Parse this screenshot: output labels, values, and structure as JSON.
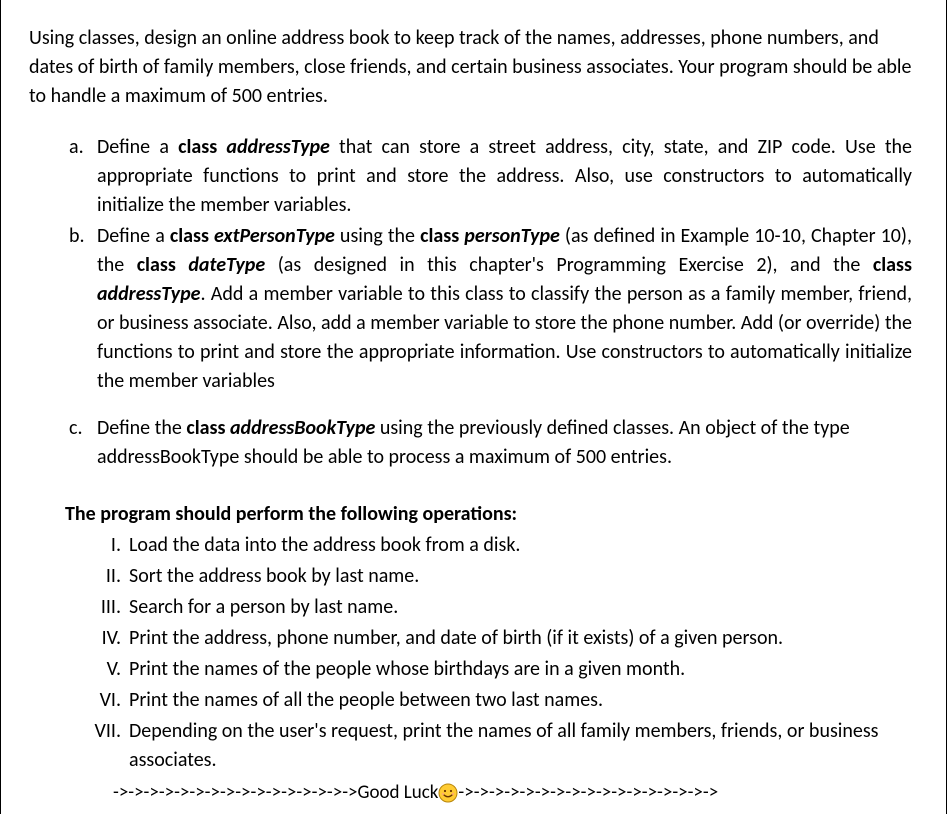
{
  "intro": "Using classes, design an online address book to keep track of the names, addresses, phone numbers, and dates of birth of family members, close friends, and certain business associates. Your program should be able to handle a maximum of 500 entries.",
  "letters": {
    "a": {
      "marker": "a.",
      "pre1": "Define a ",
      "class_word": "class ",
      "class_name": "addressType",
      "post1": " that can store a street address, city, state,  and ZIP code. Use the appropriate functions to print and store the address. Also, use constructors to automatically initialize the member variables."
    },
    "b": {
      "marker": "b.",
      "pre1": "Define a ",
      "class_word1": "class ",
      "class_name1": "extPersonType",
      "mid1": " using the ",
      "class_word2": "class ",
      "class_name2": "personType",
      "mid2": " (as defined in Example 10-10, Chapter 10), the ",
      "class_word3": "class ",
      "class_name3": "dateType",
      "mid3": " (as designed in this chapter's Programming Exercise 2), and the ",
      "class_word4": "class ",
      "class_name4": "addressType",
      "post1": ". Add a member variable to this class to classify the person as a family member, friend, or business associate. Also, add a member variable to store the phone number. Add (or override) the functions to print and store the appropriate information. Use constructors to automatically initialize the member variables"
    },
    "c": {
      "marker": "c.",
      "pre1": "Define the ",
      "class_word": "class ",
      "class_name": "addressBookType",
      "post1": " using the previously defined classes. An object of the type addressBookType should be able to process a maximum of 500 entries."
    }
  },
  "ops_header": "The program should perform the following operations:",
  "roman": {
    "i1": {
      "marker": "I.",
      "text": "Load the data into the address book from a disk."
    },
    "i2": {
      "marker": "II.",
      "text": "Sort the address book by last name."
    },
    "i3": {
      "marker": "III.",
      "text": "Search for a person by last name."
    },
    "i4": {
      "marker": "IV.",
      "text": "Print the address, phone number, and date of birth (if it exists) of a given person."
    },
    "i5": {
      "marker": "V.",
      "text": "Print the names of the people whose birthdays are in a given month."
    },
    "i6": {
      "marker": "VI.",
      "text": "Print the names of all the people between two last names."
    },
    "i7": {
      "marker": "VII.",
      "text": "Depending on the user's request, print the names of all family members, friends, or business associates."
    }
  },
  "footer": {
    "left": "->->->->->->->->->->->->->->->->Good Luck",
    "right": "->->->->->->->->->->->->->->->->->"
  }
}
